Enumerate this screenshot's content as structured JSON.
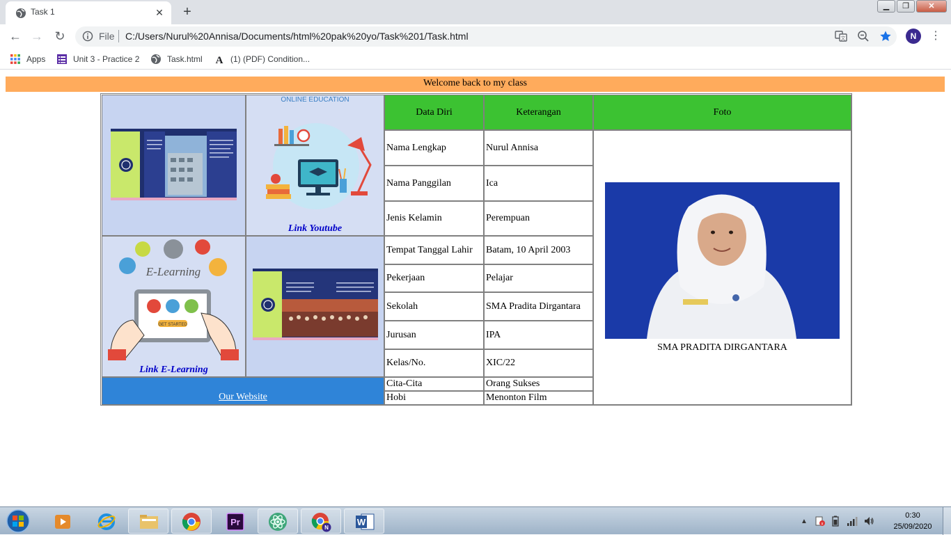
{
  "browser": {
    "tab_title": "Task 1",
    "tab_close": "✕",
    "new_tab": "+",
    "scheme": "File",
    "url": "C:/Users/Nurul%20Annisa/Documents/html%20pak%20yo/Task%201/Task.html",
    "avatar_letter": "N",
    "bookmarks": [
      {
        "label": "Apps",
        "icon": "apps-grid-icon"
      },
      {
        "label": "Unit 3 - Practice 2",
        "icon": "doc-icon"
      },
      {
        "label": "Task.html",
        "icon": "globe-icon"
      },
      {
        "label": "(1) (PDF) Condition...",
        "icon": "academia-icon"
      }
    ]
  },
  "page": {
    "welcome": "Welcome back to my class",
    "online_education": "ONLINE EDUCATION",
    "link_youtube": "Link Youtube",
    "link_elearning": "Link E-Learning",
    "elearning_title": "E-Learning",
    "get_started": "GET STARTED",
    "our_website": "Our Website",
    "headers": {
      "data_diri": "Data Diri",
      "keterangan": "Keterangan",
      "foto": "Foto"
    },
    "rows": [
      {
        "label": "Nama Lengkap",
        "value": "Nurul Annisa"
      },
      {
        "label": "Nama Panggilan",
        "value": "Ica"
      },
      {
        "label": "Jenis Kelamin",
        "value": "Perempuan"
      },
      {
        "label": "Tempat Tanggal Lahir",
        "value": "Batam, 10 April 2003"
      },
      {
        "label": "Pekerjaan",
        "value": "Pelajar"
      },
      {
        "label": "Sekolah",
        "value": "SMA Pradita Dirgantara"
      },
      {
        "label": "Jurusan",
        "value": "IPA"
      },
      {
        "label": "Kelas/No.",
        "value": "XIC/22"
      },
      {
        "label": "Cita-Cita",
        "value": "Orang Sukses"
      },
      {
        "label": "Hobi",
        "value": "Menonton Film"
      }
    ],
    "photo_caption": "SMA PRADITA DIRGANTARA"
  },
  "taskbar": {
    "time": "0:30",
    "date": "25/09/2020"
  },
  "colors": {
    "welcome_bg": "#ffab5c",
    "header_green": "#3cc232",
    "website_blue": "#2f84d8",
    "cell_lavender": "#c7d4f1",
    "photo_bg": "#1a3aa8"
  }
}
